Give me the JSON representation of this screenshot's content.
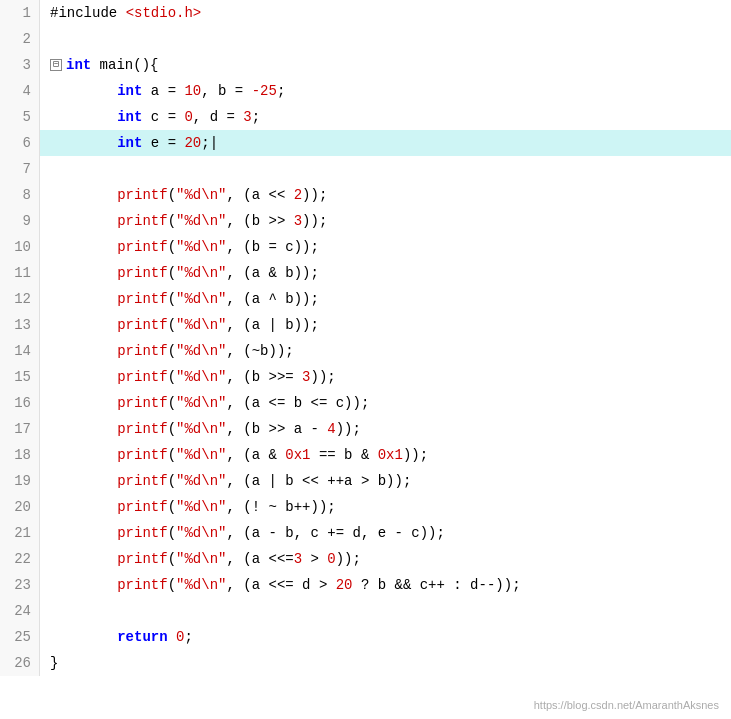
{
  "editor": {
    "watermark": "https://blog.csdn.net/AmaranthAksnes"
  },
  "lines": [
    {
      "num": 1,
      "tokens": [
        {
          "t": "include",
          "c": "plain",
          "text": "#include "
        },
        {
          "t": "include-text",
          "c": "include-text",
          "text": "<stdio.h>"
        }
      ],
      "highlight": false
    },
    {
      "num": 2,
      "tokens": [],
      "highlight": false
    },
    {
      "num": 3,
      "tokens": [
        {
          "t": "fold",
          "c": "fold",
          "text": "⊟"
        },
        {
          "t": "kw",
          "c": "kw",
          "text": "int"
        },
        {
          "t": "plain",
          "c": "plain",
          "text": " main(){"
        }
      ],
      "highlight": false
    },
    {
      "num": 4,
      "tokens": [
        {
          "t": "plain",
          "c": "plain",
          "text": "        "
        },
        {
          "t": "kw",
          "c": "kw",
          "text": "int"
        },
        {
          "t": "plain",
          "c": "plain",
          "text": " a = "
        },
        {
          "t": "num",
          "c": "num",
          "text": "10"
        },
        {
          "t": "plain",
          "c": "plain",
          "text": ", b = "
        },
        {
          "t": "num",
          "c": "num",
          "text": "-25"
        },
        {
          "t": "plain",
          "c": "plain",
          "text": ";"
        }
      ],
      "highlight": false
    },
    {
      "num": 5,
      "tokens": [
        {
          "t": "plain",
          "c": "plain",
          "text": "        "
        },
        {
          "t": "kw",
          "c": "kw",
          "text": "int"
        },
        {
          "t": "plain",
          "c": "plain",
          "text": " c = "
        },
        {
          "t": "num",
          "c": "num",
          "text": "0"
        },
        {
          "t": "plain",
          "c": "plain",
          "text": ", d = "
        },
        {
          "t": "num",
          "c": "num",
          "text": "3"
        },
        {
          "t": "plain",
          "c": "plain",
          "text": ";"
        }
      ],
      "highlight": false
    },
    {
      "num": 6,
      "tokens": [
        {
          "t": "plain",
          "c": "plain",
          "text": "        "
        },
        {
          "t": "kw",
          "c": "kw",
          "text": "int"
        },
        {
          "t": "plain",
          "c": "plain",
          "text": " e = "
        },
        {
          "t": "num",
          "c": "num",
          "text": "20"
        },
        {
          "t": "plain",
          "c": "plain",
          "text": ";|"
        }
      ],
      "highlight": true
    },
    {
      "num": 7,
      "tokens": [],
      "highlight": false
    },
    {
      "num": 8,
      "tokens": [
        {
          "t": "plain",
          "c": "plain",
          "text": "        "
        },
        {
          "t": "func",
          "c": "func",
          "text": "printf"
        },
        {
          "t": "plain",
          "c": "plain",
          "text": "("
        },
        {
          "t": "str",
          "c": "str",
          "text": "\"%d\\n\""
        },
        {
          "t": "plain",
          "c": "plain",
          "text": ", (a << "
        },
        {
          "t": "num",
          "c": "num",
          "text": "2"
        },
        {
          "t": "plain",
          "c": "plain",
          "text": "));"
        }
      ],
      "highlight": false
    },
    {
      "num": 9,
      "tokens": [
        {
          "t": "plain",
          "c": "plain",
          "text": "        "
        },
        {
          "t": "func",
          "c": "func",
          "text": "printf"
        },
        {
          "t": "plain",
          "c": "plain",
          "text": "("
        },
        {
          "t": "str",
          "c": "str",
          "text": "\"%d\\n\""
        },
        {
          "t": "plain",
          "c": "plain",
          "text": ", (b >> "
        },
        {
          "t": "num",
          "c": "num",
          "text": "3"
        },
        {
          "t": "plain",
          "c": "plain",
          "text": "));"
        }
      ],
      "highlight": false
    },
    {
      "num": 10,
      "tokens": [
        {
          "t": "plain",
          "c": "plain",
          "text": "        "
        },
        {
          "t": "func",
          "c": "func",
          "text": "printf"
        },
        {
          "t": "plain",
          "c": "plain",
          "text": "("
        },
        {
          "t": "str",
          "c": "str",
          "text": "\"%d\\n\""
        },
        {
          "t": "plain",
          "c": "plain",
          "text": ", (b = c));"
        }
      ],
      "highlight": false
    },
    {
      "num": 11,
      "tokens": [
        {
          "t": "plain",
          "c": "plain",
          "text": "        "
        },
        {
          "t": "func",
          "c": "func",
          "text": "printf"
        },
        {
          "t": "plain",
          "c": "plain",
          "text": "("
        },
        {
          "t": "str",
          "c": "str",
          "text": "\"%d\\n\""
        },
        {
          "t": "plain",
          "c": "plain",
          "text": ", (a & b));"
        }
      ],
      "highlight": false
    },
    {
      "num": 12,
      "tokens": [
        {
          "t": "plain",
          "c": "plain",
          "text": "        "
        },
        {
          "t": "func",
          "c": "func",
          "text": "printf"
        },
        {
          "t": "plain",
          "c": "plain",
          "text": "("
        },
        {
          "t": "str",
          "c": "str",
          "text": "\"%d\\n\""
        },
        {
          "t": "plain",
          "c": "plain",
          "text": ", (a ^ b));"
        }
      ],
      "highlight": false
    },
    {
      "num": 13,
      "tokens": [
        {
          "t": "plain",
          "c": "plain",
          "text": "        "
        },
        {
          "t": "func",
          "c": "func",
          "text": "printf"
        },
        {
          "t": "plain",
          "c": "plain",
          "text": "("
        },
        {
          "t": "str",
          "c": "str",
          "text": "\"%d\\n\""
        },
        {
          "t": "plain",
          "c": "plain",
          "text": ", (a | b));"
        }
      ],
      "highlight": false
    },
    {
      "num": 14,
      "tokens": [
        {
          "t": "plain",
          "c": "plain",
          "text": "        "
        },
        {
          "t": "func",
          "c": "func",
          "text": "printf"
        },
        {
          "t": "plain",
          "c": "plain",
          "text": "("
        },
        {
          "t": "str",
          "c": "str",
          "text": "\"%d\\n\""
        },
        {
          "t": "plain",
          "c": "plain",
          "text": ", (~b));"
        }
      ],
      "highlight": false
    },
    {
      "num": 15,
      "tokens": [
        {
          "t": "plain",
          "c": "plain",
          "text": "        "
        },
        {
          "t": "func",
          "c": "func",
          "text": "printf"
        },
        {
          "t": "plain",
          "c": "plain",
          "text": "("
        },
        {
          "t": "str",
          "c": "str",
          "text": "\"%d\\n\""
        },
        {
          "t": "plain",
          "c": "plain",
          "text": ", (b >>= "
        },
        {
          "t": "num",
          "c": "num",
          "text": "3"
        },
        {
          "t": "plain",
          "c": "plain",
          "text": "));"
        }
      ],
      "highlight": false
    },
    {
      "num": 16,
      "tokens": [
        {
          "t": "plain",
          "c": "plain",
          "text": "        "
        },
        {
          "t": "func",
          "c": "func",
          "text": "printf"
        },
        {
          "t": "plain",
          "c": "plain",
          "text": "("
        },
        {
          "t": "str",
          "c": "str",
          "text": "\"%d\\n\""
        },
        {
          "t": "plain",
          "c": "plain",
          "text": ", (a <= b <= c));"
        }
      ],
      "highlight": false
    },
    {
      "num": 17,
      "tokens": [
        {
          "t": "plain",
          "c": "plain",
          "text": "        "
        },
        {
          "t": "func",
          "c": "func",
          "text": "printf"
        },
        {
          "t": "plain",
          "c": "plain",
          "text": "("
        },
        {
          "t": "str",
          "c": "str",
          "text": "\"%d\\n\""
        },
        {
          "t": "plain",
          "c": "plain",
          "text": ", (b >> a - "
        },
        {
          "t": "num",
          "c": "num",
          "text": "4"
        },
        {
          "t": "plain",
          "c": "plain",
          "text": "));"
        }
      ],
      "highlight": false
    },
    {
      "num": 18,
      "tokens": [
        {
          "t": "plain",
          "c": "plain",
          "text": "        "
        },
        {
          "t": "func",
          "c": "func",
          "text": "printf"
        },
        {
          "t": "plain",
          "c": "plain",
          "text": "("
        },
        {
          "t": "str",
          "c": "str",
          "text": "\"%d\\n\""
        },
        {
          "t": "plain",
          "c": "plain",
          "text": ", (a & "
        },
        {
          "t": "num",
          "c": "num",
          "text": "0x1"
        },
        {
          "t": "plain",
          "c": "plain",
          "text": " == b & "
        },
        {
          "t": "num",
          "c": "num",
          "text": "0x1"
        },
        {
          "t": "plain",
          "c": "plain",
          "text": "));"
        }
      ],
      "highlight": false
    },
    {
      "num": 19,
      "tokens": [
        {
          "t": "plain",
          "c": "plain",
          "text": "        "
        },
        {
          "t": "func",
          "c": "func",
          "text": "printf"
        },
        {
          "t": "plain",
          "c": "plain",
          "text": "("
        },
        {
          "t": "str",
          "c": "str",
          "text": "\"%d\\n\""
        },
        {
          "t": "plain",
          "c": "plain",
          "text": ", (a | b << ++a > b));"
        }
      ],
      "highlight": false
    },
    {
      "num": 20,
      "tokens": [
        {
          "t": "plain",
          "c": "plain",
          "text": "        "
        },
        {
          "t": "func",
          "c": "func",
          "text": "printf"
        },
        {
          "t": "plain",
          "c": "plain",
          "text": "("
        },
        {
          "t": "str",
          "c": "str",
          "text": "\"%d\\n\""
        },
        {
          "t": "plain",
          "c": "plain",
          "text": ", (! ~ b++));"
        }
      ],
      "highlight": false
    },
    {
      "num": 21,
      "tokens": [
        {
          "t": "plain",
          "c": "plain",
          "text": "        "
        },
        {
          "t": "func",
          "c": "func",
          "text": "printf"
        },
        {
          "t": "plain",
          "c": "plain",
          "text": "("
        },
        {
          "t": "str",
          "c": "str",
          "text": "\"%d\\n\""
        },
        {
          "t": "plain",
          "c": "plain",
          "text": ", (a - b, c += d, e - c));"
        }
      ],
      "highlight": false
    },
    {
      "num": 22,
      "tokens": [
        {
          "t": "plain",
          "c": "plain",
          "text": "        "
        },
        {
          "t": "func",
          "c": "func",
          "text": "printf"
        },
        {
          "t": "plain",
          "c": "plain",
          "text": "("
        },
        {
          "t": "str",
          "c": "str",
          "text": "\"%d\\n\""
        },
        {
          "t": "plain",
          "c": "plain",
          "text": ", (a <<="
        },
        {
          "t": "num",
          "c": "num",
          "text": "3"
        },
        {
          "t": "plain",
          "c": "plain",
          "text": " > "
        },
        {
          "t": "num",
          "c": "num",
          "text": "0"
        },
        {
          "t": "plain",
          "c": "plain",
          "text": "));"
        }
      ],
      "highlight": false
    },
    {
      "num": 23,
      "tokens": [
        {
          "t": "plain",
          "c": "plain",
          "text": "        "
        },
        {
          "t": "func",
          "c": "func",
          "text": "printf"
        },
        {
          "t": "plain",
          "c": "plain",
          "text": "("
        },
        {
          "t": "str",
          "c": "str",
          "text": "\"%d\\n\""
        },
        {
          "t": "plain",
          "c": "plain",
          "text": ", (a <<= d > "
        },
        {
          "t": "num",
          "c": "num",
          "text": "20"
        },
        {
          "t": "plain",
          "c": "plain",
          "text": " ? b && c++ : d--));"
        }
      ],
      "highlight": false
    },
    {
      "num": 24,
      "tokens": [],
      "highlight": false
    },
    {
      "num": 25,
      "tokens": [
        {
          "t": "plain",
          "c": "plain",
          "text": "        "
        },
        {
          "t": "kw",
          "c": "kw",
          "text": "return"
        },
        {
          "t": "plain",
          "c": "plain",
          "text": " "
        },
        {
          "t": "num",
          "c": "num",
          "text": "0"
        },
        {
          "t": "plain",
          "c": "plain",
          "text": ";"
        }
      ],
      "highlight": false
    },
    {
      "num": 26,
      "tokens": [
        {
          "t": "plain",
          "c": "plain",
          "text": "}"
        }
      ],
      "highlight": false
    }
  ]
}
